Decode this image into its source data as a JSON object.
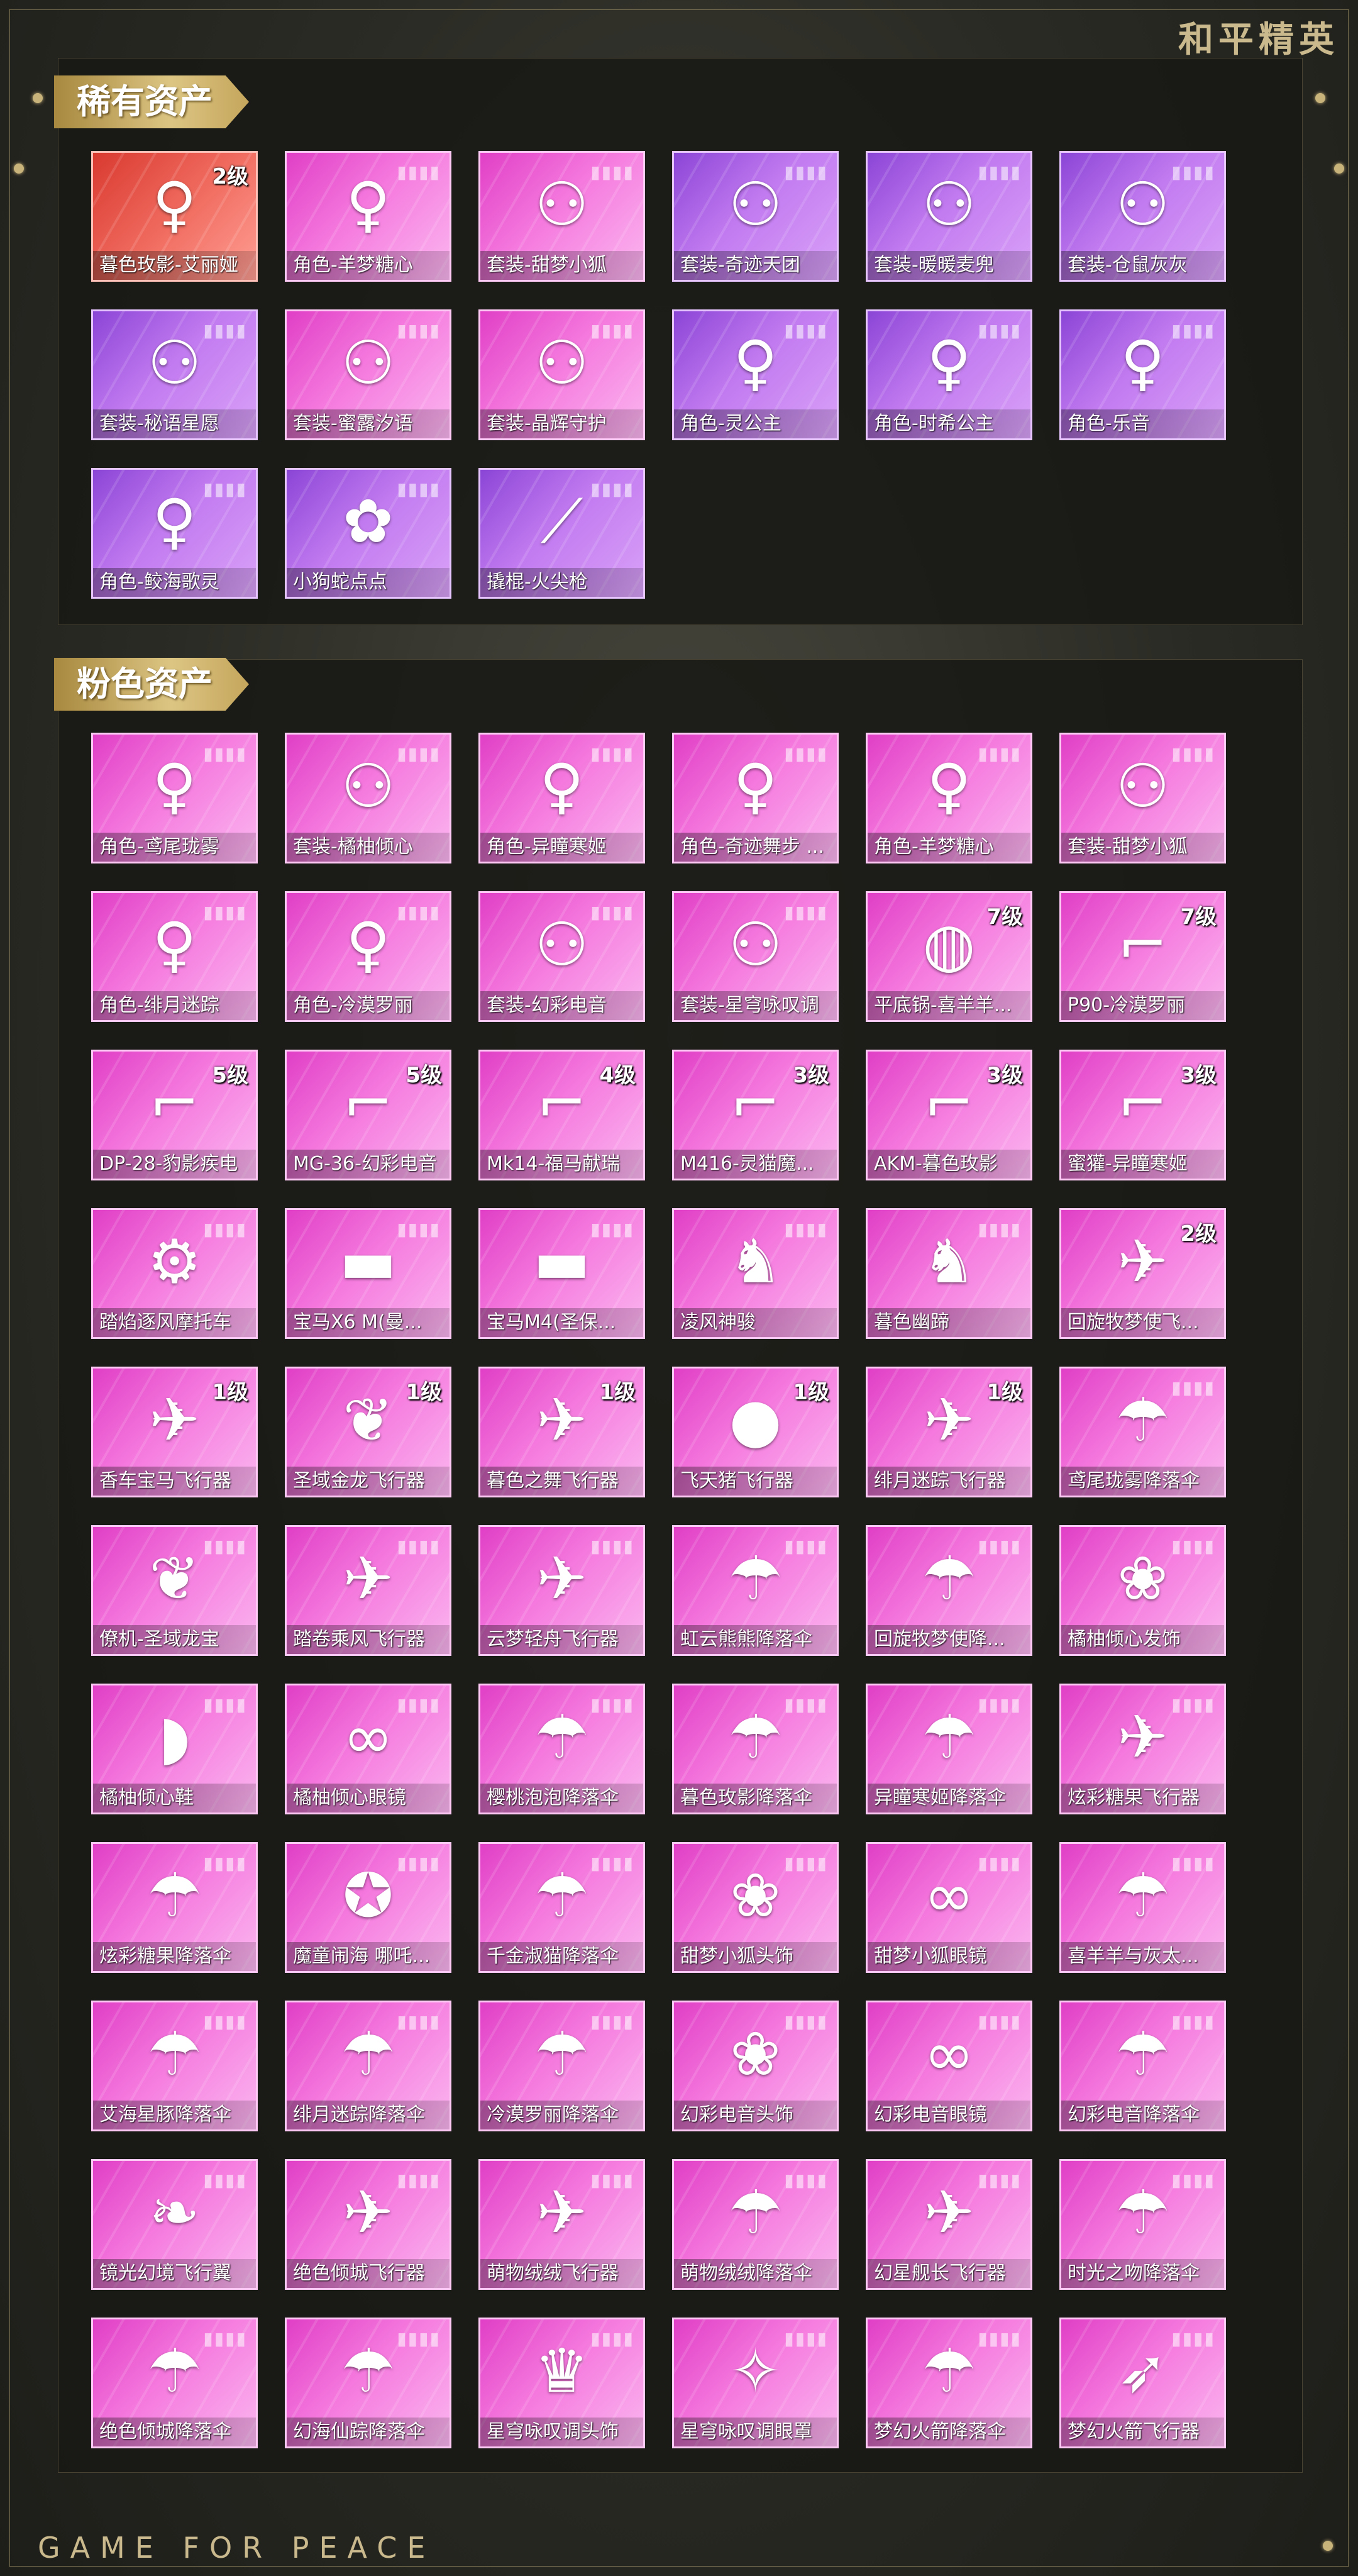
{
  "brand": {
    "top": "和平精英",
    "bottom": "GAME FOR PEACE"
  },
  "sections": {
    "rare": {
      "title": "稀有资产"
    },
    "pink": {
      "title": "粉色资产"
    }
  },
  "colors": {
    "purple_card": "#b66ae8",
    "pink_card": "#f06ad8",
    "red_card": "#ea5448",
    "gold_title": "#d8bf7c"
  },
  "rare_items": [
    {
      "label": "暮色玫影-艾丽娅",
      "level": "2级",
      "style": "red",
      "icon": "character-icon"
    },
    {
      "label": "角色-羊梦糖心",
      "level": "",
      "style": "pink",
      "icon": "character-icon"
    },
    {
      "label": "套装-甜梦小狐",
      "level": "",
      "style": "pink",
      "icon": "outfit-pair-icon"
    },
    {
      "label": "套装-奇迹天团",
      "level": "",
      "style": "purple",
      "icon": "outfit-pair-icon"
    },
    {
      "label": "套装-暖暖麦兜",
      "level": "",
      "style": "purple",
      "icon": "outfit-pair-icon"
    },
    {
      "label": "套装-仓鼠灰灰",
      "level": "",
      "style": "purple",
      "icon": "outfit-pair-icon"
    },
    {
      "label": "套装-秘语星愿",
      "level": "",
      "style": "purple",
      "icon": "outfit-pair-icon"
    },
    {
      "label": "套装-蜜露汐语",
      "level": "",
      "style": "pink",
      "icon": "outfit-pair-icon"
    },
    {
      "label": "套装-晶辉守护",
      "level": "",
      "style": "pink",
      "icon": "outfit-pair-icon"
    },
    {
      "label": "角色-灵公主",
      "level": "",
      "style": "purple",
      "icon": "character-icon"
    },
    {
      "label": "角色-时希公主",
      "level": "",
      "style": "purple",
      "icon": "character-icon"
    },
    {
      "label": "角色-乐音",
      "level": "",
      "style": "purple",
      "icon": "character-icon"
    },
    {
      "label": "角色-鲛海歌灵",
      "level": "",
      "style": "purple",
      "icon": "character-icon"
    },
    {
      "label": "小狗蛇点点",
      "level": "",
      "style": "purple",
      "icon": "pet-icon"
    },
    {
      "label": "撬棍-火尖枪",
      "level": "",
      "style": "purple",
      "icon": "spear-icon"
    }
  ],
  "pink_items": [
    {
      "label": "角色-鸢尾珑雾",
      "level": "",
      "icon": "character-icon"
    },
    {
      "label": "套装-橘柚倾心",
      "level": "",
      "icon": "outfit-pair-icon"
    },
    {
      "label": "角色-异瞳寒姬",
      "level": "",
      "icon": "character-icon"
    },
    {
      "label": "角色-奇迹舞步 ...",
      "level": "",
      "icon": "character-icon"
    },
    {
      "label": "角色-羊梦糖心",
      "level": "",
      "icon": "character-icon"
    },
    {
      "label": "套装-甜梦小狐",
      "level": "",
      "icon": "outfit-pair-icon"
    },
    {
      "label": "角色-绯月迷踪",
      "level": "",
      "icon": "character-icon"
    },
    {
      "label": "角色-冷漠罗丽",
      "level": "",
      "icon": "character-icon"
    },
    {
      "label": "套装-幻彩电音",
      "level": "",
      "icon": "outfit-pair-icon"
    },
    {
      "label": "套装-星穹咏叹调",
      "level": "",
      "icon": "outfit-pair-icon"
    },
    {
      "label": "平底锅-喜羊羊...",
      "level": "7级",
      "icon": "pan-icon"
    },
    {
      "label": "P90-冷漠罗丽",
      "level": "7级",
      "icon": "gun-icon"
    },
    {
      "label": "DP-28-豹影疾电",
      "level": "5级",
      "icon": "gun-icon"
    },
    {
      "label": "MG-36-幻彩电音",
      "level": "5级",
      "icon": "gun-icon"
    },
    {
      "label": "Mk14-福马献瑞",
      "level": "4级",
      "icon": "gun-icon"
    },
    {
      "label": "M416-灵猫魔...",
      "level": "3级",
      "icon": "gun-icon"
    },
    {
      "label": "AKM-暮色玫影",
      "level": "3级",
      "icon": "gun-icon"
    },
    {
      "label": "蜜獾-异瞳寒姬",
      "level": "3级",
      "icon": "gun-icon"
    },
    {
      "label": "踏焰逐风摩托车",
      "level": "",
      "icon": "motorcycle-icon"
    },
    {
      "label": "宝马X6 M(曼...",
      "level": "",
      "icon": "car-icon"
    },
    {
      "label": "宝马M4(圣保...",
      "level": "",
      "icon": "car-icon"
    },
    {
      "label": "凌风神骏",
      "level": "",
      "icon": "horse-icon"
    },
    {
      "label": "暮色幽蹄",
      "level": "",
      "icon": "horse-icon"
    },
    {
      "label": "回旋牧梦使飞...",
      "level": "2级",
      "icon": "glider-icon"
    },
    {
      "label": "香车宝马飞行器",
      "level": "1级",
      "icon": "glider-icon"
    },
    {
      "label": "圣域金龙飞行器",
      "level": "1级",
      "icon": "dragon-icon"
    },
    {
      "label": "暮色之舞飞行器",
      "level": "1级",
      "icon": "glider-icon"
    },
    {
      "label": "飞天猪飞行器",
      "level": "1级",
      "icon": "pig-icon"
    },
    {
      "label": "绯月迷踪飞行器",
      "level": "1级",
      "icon": "glider-icon"
    },
    {
      "label": "鸢尾珑雾降落伞",
      "level": "",
      "icon": "parachute-icon"
    },
    {
      "label": "僚机-圣域龙宝",
      "level": "",
      "icon": "dragon-icon"
    },
    {
      "label": "踏卷乘风飞行器",
      "level": "",
      "icon": "glider-icon"
    },
    {
      "label": "云梦轻舟飞行器",
      "level": "",
      "icon": "glider-icon"
    },
    {
      "label": "虹云熊熊降落伞",
      "level": "",
      "icon": "parachute-icon"
    },
    {
      "label": "回旋牧梦使降...",
      "level": "",
      "icon": "parachute-icon"
    },
    {
      "label": "橘柚倾心发饰",
      "level": "",
      "icon": "hair-accessory-icon"
    },
    {
      "label": "橘柚倾心鞋",
      "level": "",
      "icon": "shoes-icon"
    },
    {
      "label": "橘柚倾心眼镜",
      "level": "",
      "icon": "glasses-icon"
    },
    {
      "label": "樱桃泡泡降落伞",
      "level": "",
      "icon": "parachute-icon"
    },
    {
      "label": "暮色玫影降落伞",
      "level": "",
      "icon": "parachute-icon"
    },
    {
      "label": "异瞳寒姬降落伞",
      "level": "",
      "icon": "parachute-icon"
    },
    {
      "label": "炫彩糖果飞行器",
      "level": "",
      "icon": "glider-icon"
    },
    {
      "label": "炫彩糖果降落伞",
      "level": "",
      "icon": "parachute-icon"
    },
    {
      "label": "魔童闹海 哪吒...",
      "level": "",
      "icon": "emblem-icon"
    },
    {
      "label": "千金淑猫降落伞",
      "level": "",
      "icon": "parachute-icon"
    },
    {
      "label": "甜梦小狐头饰",
      "level": "",
      "icon": "hair-accessory-icon"
    },
    {
      "label": "甜梦小狐眼镜",
      "level": "",
      "icon": "glasses-icon"
    },
    {
      "label": "喜羊羊与灰太...",
      "level": "",
      "icon": "parachute-icon"
    },
    {
      "label": "艾海星豚降落伞",
      "level": "",
      "icon": "parachute-icon"
    },
    {
      "label": "绯月迷踪降落伞",
      "level": "",
      "icon": "parachute-icon"
    },
    {
      "label": "冷漠罗丽降落伞",
      "level": "",
      "icon": "parachute-icon"
    },
    {
      "label": "幻彩电音头饰",
      "level": "",
      "icon": "hair-accessory-icon"
    },
    {
      "label": "幻彩电音眼镜",
      "level": "",
      "icon": "glasses-icon"
    },
    {
      "label": "幻彩电音降落伞",
      "level": "",
      "icon": "parachute-icon"
    },
    {
      "label": "镜光幻境飞行翼",
      "level": "",
      "icon": "wing-icon"
    },
    {
      "label": "绝色倾城飞行器",
      "level": "",
      "icon": "glider-icon"
    },
    {
      "label": "萌物绒绒飞行器",
      "level": "",
      "icon": "glider-icon"
    },
    {
      "label": "萌物绒绒降落伞",
      "level": "",
      "icon": "parachute-icon"
    },
    {
      "label": "幻星舰长飞行器",
      "level": "",
      "icon": "glider-icon"
    },
    {
      "label": "时光之吻降落伞",
      "level": "",
      "icon": "parachute-icon"
    },
    {
      "label": "绝色倾城降落伞",
      "level": "",
      "icon": "parachute-icon"
    },
    {
      "label": "幻海仙踪降落伞",
      "level": "",
      "icon": "parachute-icon"
    },
    {
      "label": "星穹咏叹调头饰",
      "level": "",
      "icon": "hat-icon"
    },
    {
      "label": "星穹咏叹调眼罩",
      "level": "",
      "icon": "mask-icon"
    },
    {
      "label": "梦幻火箭降落伞",
      "level": "",
      "icon": "parachute-icon"
    },
    {
      "label": "梦幻火箭飞行器",
      "level": "",
      "icon": "rocket-icon"
    }
  ]
}
